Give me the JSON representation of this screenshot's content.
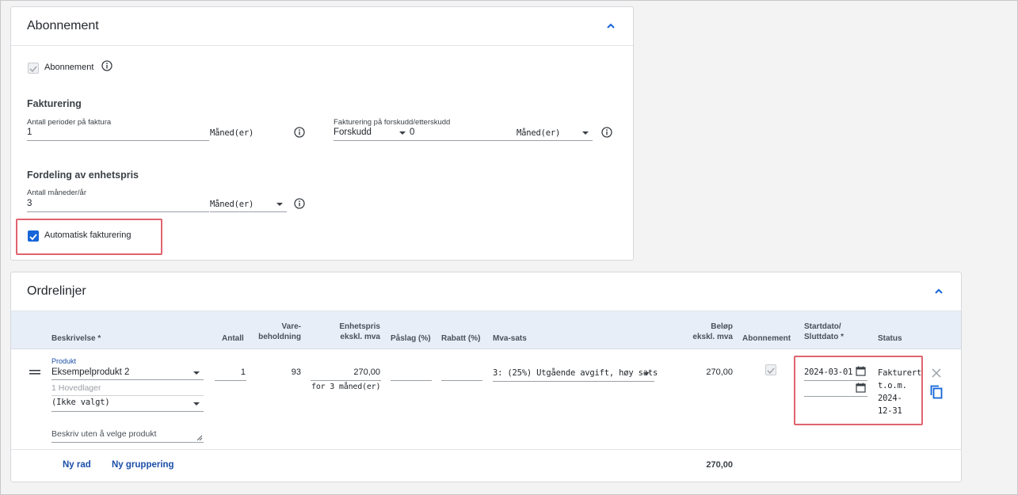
{
  "subscription_card": {
    "title": "Abonnement",
    "subscription_checkbox_label": "Abonnement",
    "invoicing": {
      "title": "Fakturering",
      "periods_label": "Antall perioder på faktura",
      "periods_value": "1",
      "periods_unit": "Måned(er)",
      "advance_label": "Fakturering på forskudd/etterskudd",
      "advance_value": "Forskudd",
      "advance_count": "0",
      "advance_unit": "Måned(er)"
    },
    "unit_price_distribution": {
      "title": "Fordeling av enhetspris",
      "months_label": "Antall måneder/år",
      "months_value": "3",
      "months_unit": "Måned(er)"
    },
    "auto_invoice_label": "Automatisk fakturering",
    "auto_invoice_checked": true
  },
  "order_lines_card": {
    "title": "Ordrelinjer",
    "headers": {
      "description": "Beskrivelse *",
      "quantity": "Antall",
      "stock_line1": "Vare-",
      "stock_line2": "beholdning",
      "unit_price_line1": "Enhetspris",
      "unit_price_line2": "ekskl. mva",
      "markup": "Påslag (%)",
      "discount": "Rabatt (%)",
      "vat": "Mva-sats",
      "amount_line1": "Beløp",
      "amount_line2": "ekskl. mva",
      "subscription": "Abonnement",
      "dates_line1": "Startdato/",
      "dates_line2": "Sluttdato *",
      "status": "Status"
    },
    "row": {
      "product_label": "Produkt",
      "product_value": "Eksempelprodukt 2",
      "warehouse": "1 Hovedlager",
      "variant_value": "(Ikke valgt)",
      "description_placeholder": "Beskriv uten å velge produkt",
      "quantity": "1",
      "stock": "93",
      "unit_price": "270,00",
      "unit_price_note": "for 3 måned(er)",
      "markup": "",
      "discount": "",
      "vat": "3: (25%) Utgående avgift, høy sats",
      "amount": "270,00",
      "start_date": "2024-03-01",
      "end_date": "",
      "status_line1": "Fakturert",
      "status_line2": "t.o.m.",
      "status_line3": "2024-",
      "status_line4": "12-31"
    },
    "footer": {
      "new_row": "Ny rad",
      "new_group": "Ny gruppering",
      "total": "270,00"
    }
  },
  "colors": {
    "accent": "#1565d8",
    "link": "#1c4fa8",
    "highlight": "#e0636e",
    "table_header": "#e8eef8"
  }
}
